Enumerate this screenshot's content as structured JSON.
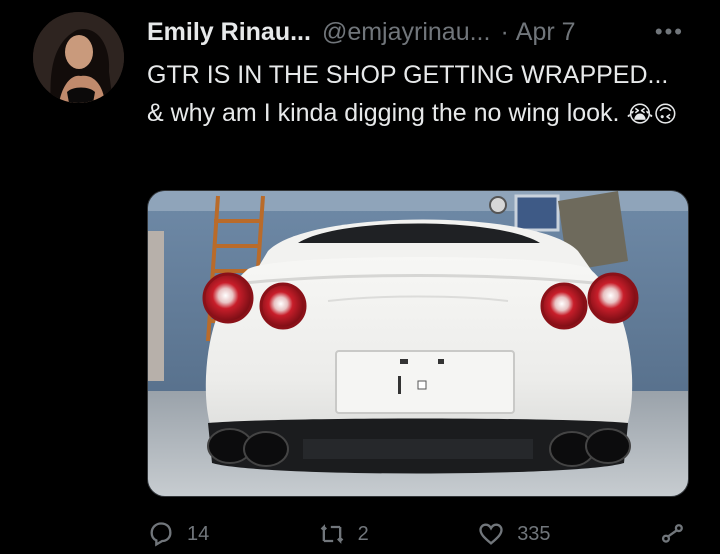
{
  "tweet": {
    "display_name": "Emily Rinau...",
    "handle": "@emjayrinau...",
    "separator": "·",
    "date": "Apr 7",
    "more_label": "•••",
    "text_main": "GTR IS IN THE SHOP GETTING WRAPPED... & why am I kinda digging the no wing look.",
    "emoji_1": "😭",
    "emoji_2": "🙃",
    "media_description_icon": "photo-white-gtr-rear"
  },
  "actions": {
    "reply_count": "14",
    "retweet_count": "2",
    "like_count": "335",
    "icons": [
      "reply-icon",
      "retweet-icon",
      "like-icon",
      "share-icon"
    ]
  },
  "colors": {
    "background": "#000000",
    "text": "#e7e9ea",
    "secondary": "#71767b",
    "border": "#333639"
  }
}
